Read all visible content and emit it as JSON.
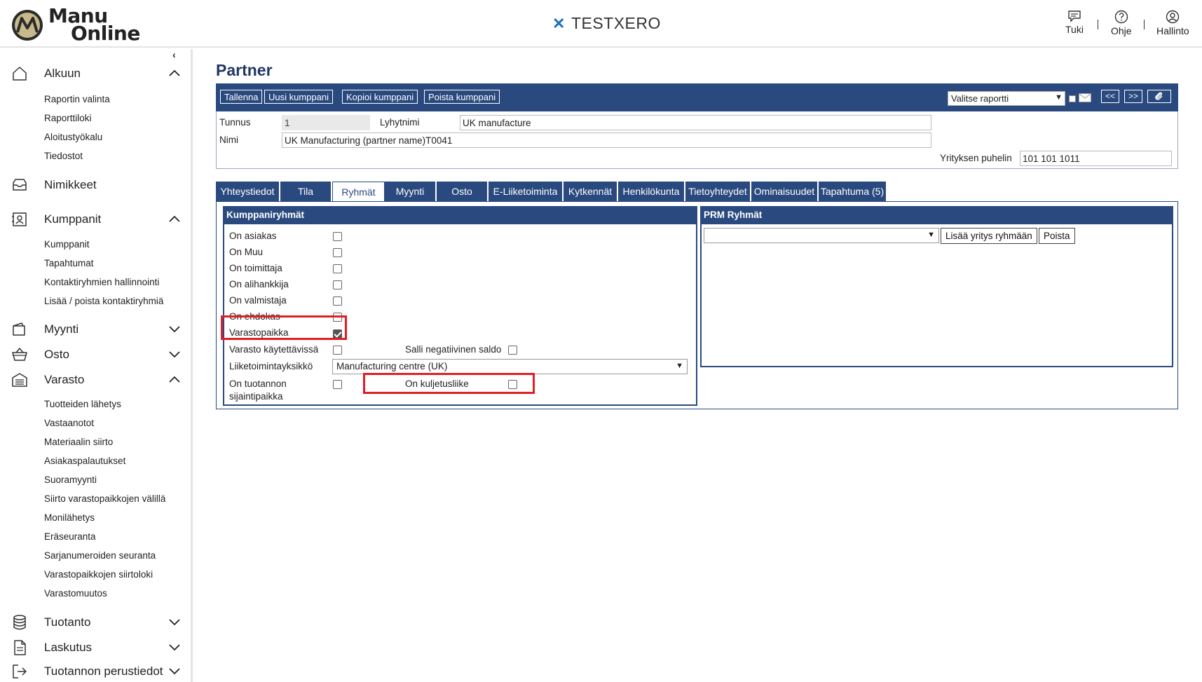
{
  "header": {
    "logo_line1": "Manu",
    "logo_line2": "Online",
    "company": "TESTXERO",
    "tools": [
      {
        "label": "Tuki",
        "icon": "chat-icon"
      },
      {
        "label": "Ohje",
        "icon": "help-icon"
      },
      {
        "label": "Hallinto",
        "icon": "user-icon"
      }
    ]
  },
  "sidebar": {
    "collapse_icon": "‹",
    "sections": [
      {
        "label": "Alkuun",
        "icon": "home-icon",
        "expanded": true,
        "items": [
          "Raportin valinta",
          "Raporttiloki",
          "Aloitustyökalu",
          "Tiedostot"
        ]
      },
      {
        "label": "Nimikkeet",
        "icon": "inbox-icon",
        "expanded": false,
        "items": []
      },
      {
        "label": "Kumppanit",
        "icon": "contact-icon",
        "expanded": true,
        "items": [
          "Kumppanit",
          "Tapahtumat",
          "Kontaktiryhmien hallinnointi",
          "Lisää / poista kontaktiryhmiä"
        ]
      },
      {
        "label": "Myynti",
        "icon": "wallet-icon",
        "expanded": false,
        "items": []
      },
      {
        "label": "Osto",
        "icon": "basket-icon",
        "expanded": false,
        "items": []
      },
      {
        "label": "Varasto",
        "icon": "warehouse-icon",
        "expanded": true,
        "items": [
          "Tuotteiden lähetys",
          "Vastaanotot",
          "Materiaalin siirto",
          "Asiakaspalautukset",
          "Suoramyynti",
          "Siirto varastopaikkojen välillä",
          "Monilähetys",
          "Eräseuranta",
          "Sarjanumeroiden seuranta",
          "Varastopaikkojen siirtoloki",
          "Varastomuutos"
        ]
      },
      {
        "label": "Tuotanto",
        "icon": "database-icon",
        "expanded": false,
        "items": []
      },
      {
        "label": "Laskutus",
        "icon": "document-icon",
        "expanded": false,
        "items": []
      },
      {
        "label": "Tuotannon perustiedot",
        "icon": "exit-icon",
        "expanded": false,
        "items": []
      }
    ]
  },
  "page": {
    "title": "Partner",
    "toolbar": {
      "buttons": [
        "Tallenna",
        "Uusi kumppani",
        "Kopioi kumppani",
        "Poista kumppani"
      ],
      "report_select": "Valitse raportti",
      "prev": "<<",
      "next": ">>",
      "attach_icon": "paperclip-icon"
    },
    "fields": {
      "tunnus_label": "Tunnus",
      "tunnus_value": "1",
      "lyhytnimi_label": "Lyhytnimi",
      "lyhytnimi_value": "UK manufacture",
      "nimi_label": "Nimi",
      "nimi_value": "UK Manufacturing (partner name)T0041",
      "puhelin_label": "Yrityksen puhelin",
      "puhelin_value": "101 101 1011"
    },
    "tabs": [
      "Yhteystiedot",
      "Tila",
      "Ryhmät",
      "Myynti",
      "Osto",
      "E-Liiketoiminta",
      "Kytkennät",
      "Henkilökunta",
      "Tietoyhteydet",
      "Ominaisuudet",
      "Tapahtuma (5)"
    ],
    "active_tab": "Ryhmät",
    "partner_groups": {
      "title": "Kumppaniryhmät",
      "rows": [
        {
          "label": "On asiakas",
          "checked": false
        },
        {
          "label": "On Muu",
          "checked": false
        },
        {
          "label": "On toimittaja",
          "checked": false
        },
        {
          "label": "On alihankkija",
          "checked": false
        },
        {
          "label": "On valmistaja",
          "checked": false
        },
        {
          "label": "On ehdokas",
          "checked": false
        },
        {
          "label": "Varastopaikka",
          "checked": true
        },
        {
          "label": "Varasto käytettävissä",
          "checked": false
        }
      ],
      "negative_balance_label": "Salli negatiivinen saldo",
      "negative_balance_checked": false,
      "business_unit_label": "Liiketoimintayksikkö",
      "business_unit_value": "Manufacturing centre (UK)",
      "production_location_label1": "On tuotannon",
      "production_location_label2": "sijaintipaikka",
      "production_location_checked": false,
      "carrier_label": "On kuljetusliike",
      "carrier_checked": false
    },
    "prm_groups": {
      "title": "PRM Ryhmät",
      "select_value": "",
      "add_button": "Lisää yritys ryhmään",
      "remove_button": "Poista"
    }
  }
}
